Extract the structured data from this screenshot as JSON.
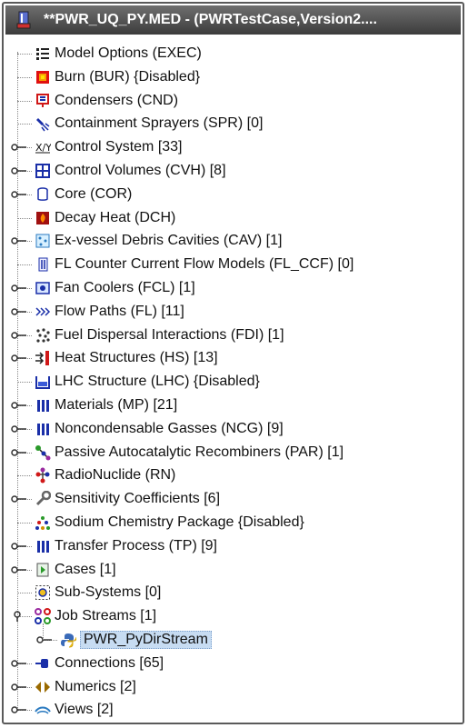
{
  "window": {
    "title": "**PWR_UQ_PY.MED - (PWRTestCase,Version2....",
    "icon": "melcor-file-icon"
  },
  "tree": {
    "items": [
      {
        "label": "Model Options (EXEC)",
        "icon": "list-icon",
        "expandable": false
      },
      {
        "label": "Burn (BUR) {Disabled}",
        "icon": "burn-icon",
        "expandable": false
      },
      {
        "label": "Condensers (CND)",
        "icon": "condenser-icon",
        "expandable": false
      },
      {
        "label": "Containment Sprayers (SPR) [0]",
        "icon": "sprayer-icon",
        "expandable": false
      },
      {
        "label": "Control System [33]",
        "icon": "control-system-icon",
        "expandable": true
      },
      {
        "label": "Control Volumes (CVH) [8]",
        "icon": "control-volume-icon",
        "expandable": true
      },
      {
        "label": "Core (COR)",
        "icon": "core-icon",
        "expandable": true
      },
      {
        "label": "Decay Heat (DCH)",
        "icon": "decay-heat-icon",
        "expandable": false
      },
      {
        "label": "Ex-vessel Debris Cavities (CAV) [1]",
        "icon": "cavity-icon",
        "expandable": true
      },
      {
        "label": "FL Counter Current Flow Models (FL_CCF) [0]",
        "icon": "ccf-icon",
        "expandable": false
      },
      {
        "label": "Fan Coolers (FCL) [1]",
        "icon": "fan-cooler-icon",
        "expandable": true
      },
      {
        "label": "Flow Paths (FL) [11]",
        "icon": "flow-path-icon",
        "expandable": true
      },
      {
        "label": "Fuel Dispersal Interactions (FDI) [1]",
        "icon": "fdi-icon",
        "expandable": true
      },
      {
        "label": "Heat Structures (HS) [13]",
        "icon": "heat-structure-icon",
        "expandable": true
      },
      {
        "label": "LHC Structure (LHC) {Disabled}",
        "icon": "lhc-icon",
        "expandable": false
      },
      {
        "label": "Materials (MP) [21]",
        "icon": "materials-icon",
        "expandable": true
      },
      {
        "label": "Noncondensable Gasses (NCG) [9]",
        "icon": "ncg-icon",
        "expandable": true
      },
      {
        "label": "Passive Autocatalytic Recombiners (PAR) [1]",
        "icon": "par-icon",
        "expandable": true
      },
      {
        "label": "RadioNuclide (RN)",
        "icon": "radionuclide-icon",
        "expandable": false
      },
      {
        "label": "Sensitivity Coefficients [6]",
        "icon": "wrench-icon",
        "expandable": true
      },
      {
        "label": "Sodium Chemistry Package {Disabled}",
        "icon": "sodium-icon",
        "expandable": false
      },
      {
        "label": "Transfer Process (TP) [9]",
        "icon": "transfer-icon",
        "expandable": true
      },
      {
        "label": "Cases [1]",
        "icon": "cases-icon",
        "expandable": true
      },
      {
        "label": "Sub-Systems [0]",
        "icon": "subsystems-icon",
        "expandable": false
      },
      {
        "label": "Job Streams [1]",
        "icon": "job-streams-icon",
        "expandable": true,
        "expanded": true
      },
      {
        "label": "PWR_PyDirStream",
        "icon": "python-icon",
        "expandable": true,
        "child": true,
        "selected": true
      },
      {
        "label": "Connections [65]",
        "icon": "connections-icon",
        "expandable": true
      },
      {
        "label": "Numerics [2]",
        "icon": "numerics-icon",
        "expandable": true
      },
      {
        "label": "Views [2]",
        "icon": "views-icon",
        "expandable": true
      }
    ]
  },
  "colors": {
    "selection": "#c7dcf2",
    "titlebar": "#4a4a4a",
    "blue_icon": "#1a2fa8",
    "red_icon": "#d01818"
  }
}
